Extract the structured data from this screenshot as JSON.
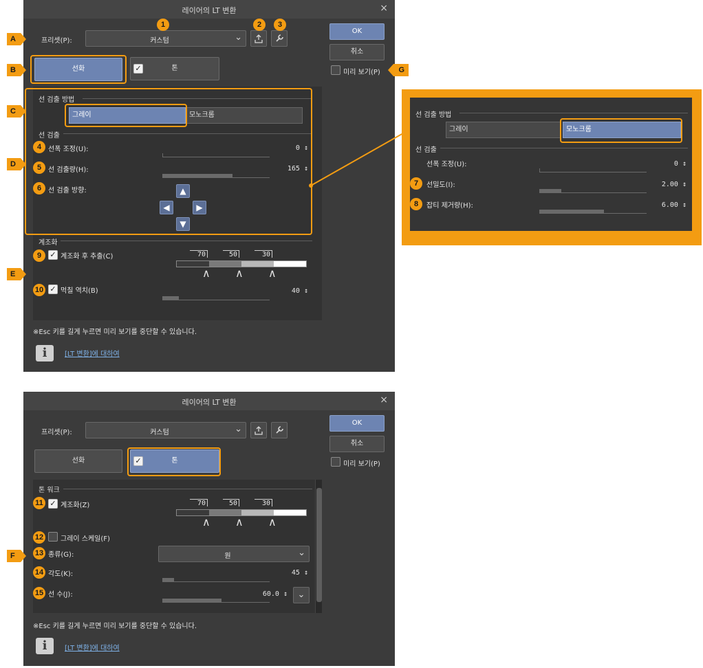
{
  "dialog1": {
    "title": "레이어의 LT 변환",
    "close": "×",
    "preset_label": "프리셋(P):",
    "preset_value": "커스텀",
    "ok": "OK",
    "cancel": "취소",
    "preview_label": "미리 보기(P)",
    "tab_line": "선화",
    "tab_tone": "톤",
    "line_method_title": "선 검출 방법",
    "gray": "그레이",
    "mono": "모노크롬",
    "line_detect_title": "선 검출",
    "line_adjust_label": "선폭 조정(U):",
    "line_adjust_value": "0",
    "line_amount_label": "선 검출량(H):",
    "line_amount_value": "165",
    "line_dir_label": "선 검출 방향:",
    "posterize_title": "계조화",
    "posterize_extract_label": "계조화 후 추출(C)",
    "ticks": [
      "70",
      "50",
      "30"
    ],
    "fill_reverse_label": "먹칠 역치(B)",
    "fill_reverse_value": "40",
    "footnote": "※Esc 키를 길게 누르면 미리 보기를 중단할 수 있습니다.",
    "link": "[LT 변환]에 대하여"
  },
  "zoom": {
    "line_method_title": "선 검출 방법",
    "gray": "그레이",
    "mono": "모노크롬",
    "line_detect_title": "선 검출",
    "line_adjust_label": "선폭 조정(U):",
    "line_adjust_value": "0",
    "density_label": "선밀도(I):",
    "density_value": "2.00",
    "noise_label": "잡티 제거량(H):",
    "noise_value": "6.00"
  },
  "dialog2": {
    "title": "레이어의 LT 변환",
    "close": "×",
    "preset_label": "프리셋(P):",
    "preset_value": "커스텀",
    "ok": "OK",
    "cancel": "취소",
    "preview_label": "미리 보기(P)",
    "tab_line": "선화",
    "tab_tone": "톤",
    "tone_work_title": "톤 워크",
    "posterize_label": "계조화(Z)",
    "ticks": [
      "70",
      "50",
      "30"
    ],
    "grayscale_label": "그레이 스케일(F)",
    "type_label": "종류(G):",
    "type_value": "원",
    "angle_label": "각도(K):",
    "angle_value": "45",
    "lines_label": "선 수(J):",
    "lines_value": "60.0",
    "footnote": "※Esc 키를 길게 누르면 미리 보기를 중단할 수 있습니다.",
    "link": "[LT 변환]에 대하여"
  },
  "markers": {
    "m1": "1",
    "m2": "2",
    "m3": "3",
    "m4": "4",
    "m5": "5",
    "m6": "6",
    "m7": "7",
    "m8": "8",
    "m9": "9",
    "m10": "10",
    "m11": "11",
    "m12": "12",
    "m13": "13",
    "m14": "14",
    "m15": "15",
    "A": "A",
    "B": "B",
    "C": "C",
    "D": "D",
    "E": "E",
    "F": "F",
    "G": "G"
  },
  "values": {
    "line_amount_fill": 0.65,
    "fill_reverse_fill": 0.15,
    "density_fill": 0.2,
    "noise_fill": 0.6,
    "angle_fill": 0.1,
    "lines_fill": 0.55
  },
  "colors": {
    "accent": "#f39c12",
    "active_blue": "#6d84b2",
    "dialog_bg": "#3b3b3b"
  }
}
